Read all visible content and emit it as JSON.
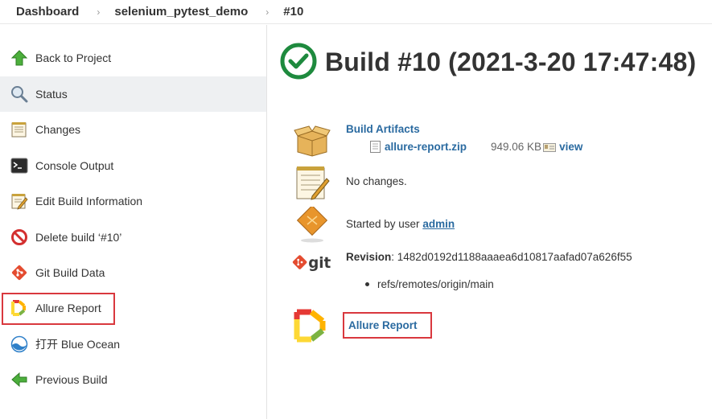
{
  "breadcrumb": {
    "items": [
      "Dashboard",
      "selenium_pytest_demo",
      "#10"
    ],
    "separator": "›"
  },
  "sidebar": {
    "items": [
      {
        "label": "Back to Project",
        "icon": "up-arrow-icon"
      },
      {
        "label": "Status",
        "icon": "magnifier-icon",
        "active": true
      },
      {
        "label": "Changes",
        "icon": "notepad-icon"
      },
      {
        "label": "Console Output",
        "icon": "terminal-icon"
      },
      {
        "label": "Edit Build Information",
        "icon": "notepad-edit-icon"
      },
      {
        "label": "Delete build ‘#10’",
        "icon": "no-entry-icon"
      },
      {
        "label": "Git Build Data",
        "icon": "git-icon"
      },
      {
        "label": "Allure Report",
        "icon": "allure-icon",
        "highlighted": true
      },
      {
        "label": "打开 Blue Ocean",
        "icon": "blue-ocean-icon"
      },
      {
        "label": "Previous Build",
        "icon": "left-arrow-icon"
      }
    ]
  },
  "main": {
    "title": "Build #10 (2021-3-20 17:47:48)",
    "status_icon": "success-check-icon",
    "artifacts": {
      "heading": "Build Artifacts",
      "file_name": "allure-report.zip",
      "file_size": "949.06 KB",
      "view_label": "view"
    },
    "changes_text": "No changes.",
    "started_by": {
      "prefix": "Started by user ",
      "user": "admin"
    },
    "revision": {
      "label": "Revision",
      "value": ": 1482d0192d1188aaaea6d10817aafad07a626f55",
      "ref": "refs/remotes/origin/main"
    },
    "allure_link": "Allure Report"
  },
  "colors": {
    "success": "#1e8a3e",
    "link": "#2a6aa0",
    "highlight": "#d9383e",
    "active_bg": "#eef0f2"
  }
}
